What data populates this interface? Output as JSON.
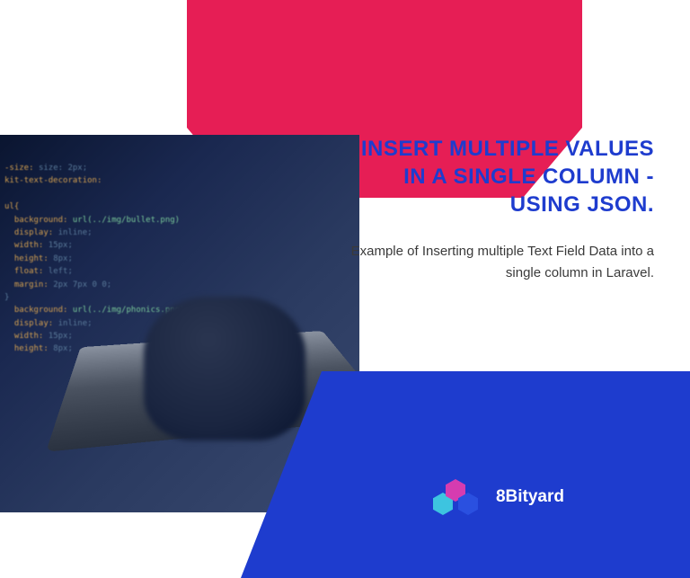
{
  "headline": "INSERT MULTIPLE VALUES IN A SINGLE COLUMN - USING JSON.",
  "subtext": "Example of Inserting multiple Text Field Data into a single column in Laravel.",
  "brand": "8Bityard",
  "code_sample": {
    "line1": "size: 2px;",
    "line2": "kit-text-decoration:",
    "line3": "ul{",
    "line4": "background: url(../img/bullet.png)",
    "line5": "display: inline;",
    "line6": "width: 15px;",
    "line7": "height: 8px;",
    "line8": "float: left;",
    "line9": "margin: 2px 7px 0 0;",
    "line10": "}",
    "line11": "background: url(../img/phonics.png) no-repeat center;",
    "line12": "display: inline;",
    "line13": "width: 15px;",
    "line14": "height: 8px;"
  }
}
